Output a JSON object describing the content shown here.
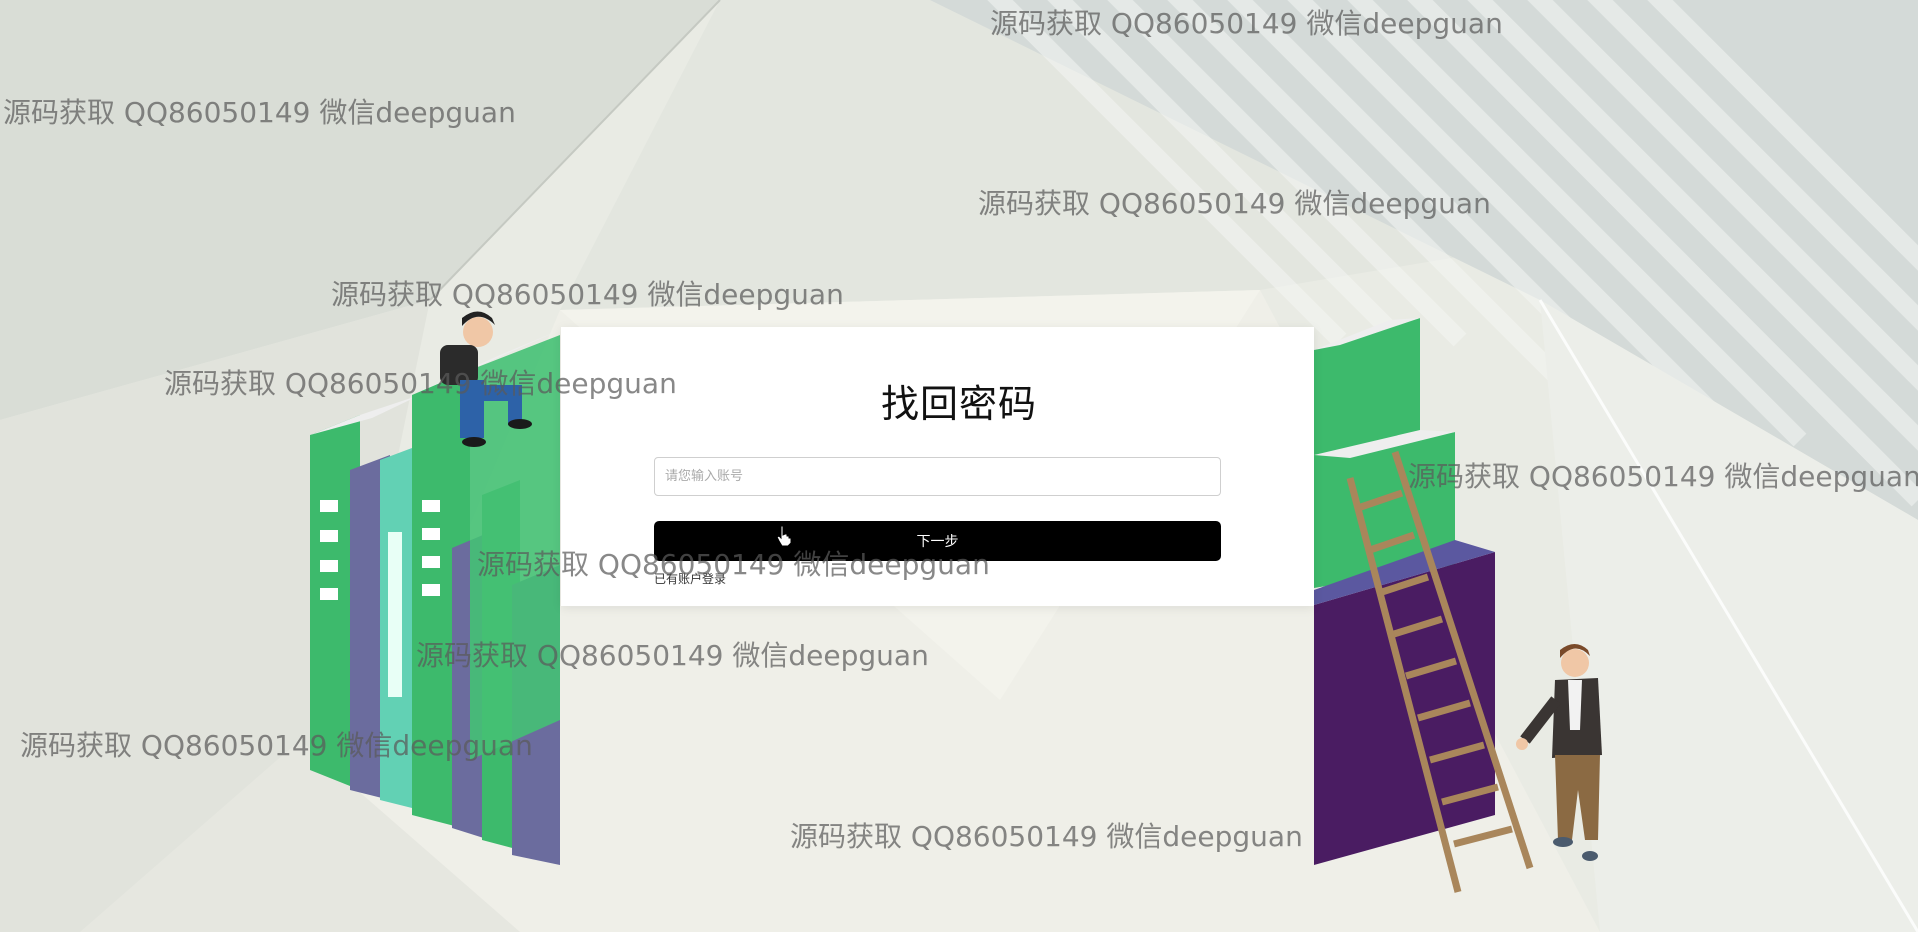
{
  "form": {
    "title": "找回密码",
    "account_placeholder": "请您输入账号",
    "next_label": "下一步",
    "login_link": "已有账户登录"
  },
  "watermarks": [
    "源码获取 QQ86050149 微信deepguan",
    "源码获取 QQ86050149 微信deepguan",
    "源码获取 QQ86050149 微信deepguan",
    "源码获取 QQ86050149 微信deepguan",
    "源码获取 QQ86050149 微信deepguan",
    "源码获取 QQ86050149 微信deepguan",
    "源码获取 QQ86050149 微信deepguan",
    "源码获取 QQ86050149 微信deepguan",
    "源码获取 QQ86050149 微信deepguan",
    "源码获取 QQ86050149 微信deepguan",
    "源码获取 QQ86050149 微信deepguan"
  ],
  "icons": {
    "cursor": "hand-pointer-icon"
  },
  "colors": {
    "button": "#000000",
    "book_green": "#3dba6c",
    "book_purple": "#4a1c62",
    "book_slate": "#6b6c9e"
  }
}
